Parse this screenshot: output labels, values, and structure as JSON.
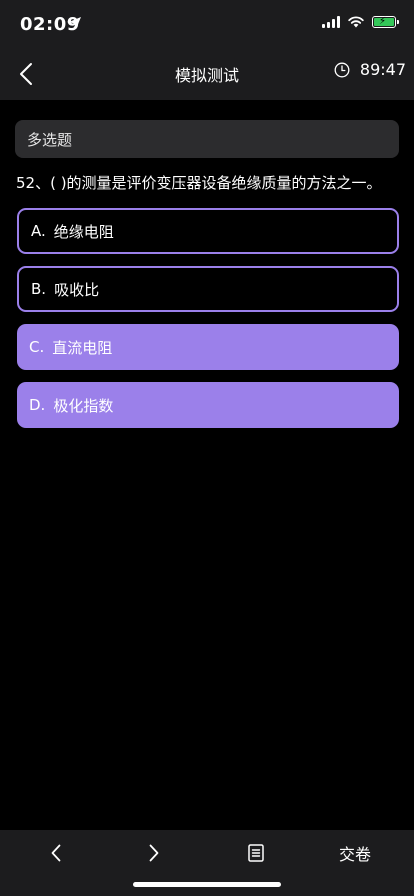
{
  "status_bar": {
    "time": "02:09"
  },
  "nav": {
    "title": "模拟测试",
    "timer": "89:47"
  },
  "question": {
    "type_label": "多选题",
    "text": "52、(   )的测量是评价变压器设备绝缘质量的方法之一。",
    "options": [
      {
        "letter": "A.",
        "text": "绝缘电阻",
        "selected": false
      },
      {
        "letter": "B.",
        "text": "吸收比",
        "selected": false
      },
      {
        "letter": "C.",
        "text": "直流电阻",
        "selected": true
      },
      {
        "letter": "D.",
        "text": "极化指数",
        "selected": true
      }
    ]
  },
  "bottom_bar": {
    "submit_label": "交卷"
  },
  "colors": {
    "accent": "#9b80ea",
    "bar_bg": "#1c1c1e",
    "battery": "#34c759"
  },
  "icons": [
    "location-arrow-icon",
    "signal-icon",
    "wifi-icon",
    "battery-icon",
    "back-chevron-icon",
    "clock-icon",
    "prev-chevron-icon",
    "next-chevron-icon",
    "answer-sheet-icon"
  ]
}
